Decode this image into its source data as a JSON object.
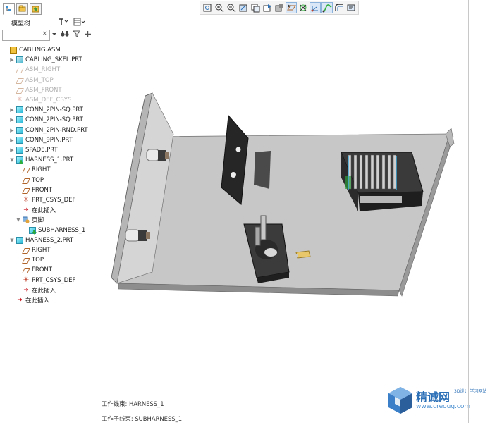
{
  "left_panel": {
    "tree_title": "模型树",
    "search": {
      "value": "",
      "clear_label": "×"
    },
    "items": [
      {
        "label": "CABLING.ASM",
        "icon": "assembly-icon",
        "toggle": "",
        "dim": false
      },
      {
        "label": "CABLING_SKEL.PRT",
        "icon": "skeleton-icon",
        "toggle": "▶",
        "dim": false
      },
      {
        "label": "ASM_RIGHT",
        "icon": "datum-plane-icon",
        "toggle": "",
        "dim": true
      },
      {
        "label": "ASM_TOP",
        "icon": "datum-plane-icon",
        "toggle": "",
        "dim": true
      },
      {
        "label": "ASM_FRONT",
        "icon": "datum-plane-icon",
        "toggle": "",
        "dim": true
      },
      {
        "label": "ASM_DEF_CSYS",
        "icon": "csys-icon",
        "toggle": "",
        "dim": true
      },
      {
        "label": "CONN_2PIN-SQ.PRT",
        "icon": "part-icon",
        "toggle": "▶",
        "dim": false
      },
      {
        "label": "CONN_2PIN-SQ.PRT",
        "icon": "part-icon",
        "toggle": "▶",
        "dim": false
      },
      {
        "label": "CONN_2PIN-RND.PRT",
        "icon": "part-icon",
        "toggle": "▶",
        "dim": false
      },
      {
        "label": "CONN_9PIN.PRT",
        "icon": "part-icon",
        "toggle": "▶",
        "dim": false
      },
      {
        "label": "SPADE.PRT",
        "icon": "part-icon",
        "toggle": "▶",
        "dim": false
      },
      {
        "label": "HARNESS_1.PRT",
        "icon": "harness-part-icon",
        "toggle": "▼",
        "dim": false
      },
      {
        "label": "RIGHT",
        "icon": "datum-plane-icon",
        "toggle": "",
        "dim": false
      },
      {
        "label": "TOP",
        "icon": "datum-plane-icon",
        "toggle": "",
        "dim": false
      },
      {
        "label": "FRONT",
        "icon": "datum-plane-icon",
        "toggle": "",
        "dim": false
      },
      {
        "label": "PRT_CSYS_DEF",
        "icon": "csys-icon",
        "toggle": "",
        "dim": false
      },
      {
        "label": "在此插入",
        "icon": "insert-here-icon",
        "toggle": "",
        "dim": false
      },
      {
        "label": "页脚",
        "icon": "footer-icon",
        "toggle": "▼",
        "dim": false
      },
      {
        "label": "SUBHARNESS_1",
        "icon": "subharness-icon",
        "toggle": "",
        "dim": false
      },
      {
        "label": "HARNESS_2.PRT",
        "icon": "part-icon",
        "toggle": "▼",
        "dim": false
      },
      {
        "label": "RIGHT",
        "icon": "datum-plane-icon",
        "toggle": "",
        "dim": false
      },
      {
        "label": "TOP",
        "icon": "datum-plane-icon",
        "toggle": "",
        "dim": false
      },
      {
        "label": "FRONT",
        "icon": "datum-plane-icon",
        "toggle": "",
        "dim": false
      },
      {
        "label": "PRT_CSYS_DEF",
        "icon": "csys-icon",
        "toggle": "",
        "dim": false
      },
      {
        "label": "在此插入",
        "icon": "insert-here-icon",
        "toggle": "",
        "dim": false
      },
      {
        "label": "在此插入",
        "icon": "insert-here-icon",
        "toggle": "",
        "dim": false
      }
    ]
  },
  "toolbar": {
    "buttons": [
      "refit-icon",
      "zoom-in-icon",
      "zoom-out-icon",
      "repaint-icon",
      "view-manager-icon",
      "saved-views-icon",
      "display-style-icon",
      "datum-display-icon",
      "spin-center-icon",
      "csys-display-icon",
      "cable-display-icon",
      "wire-icon",
      "annotation-display-icon"
    ]
  },
  "status": {
    "harness": "工作线束: HARNESS_1",
    "subharness": "工作子线束: SUBHARNESS_1"
  },
  "watermark": {
    "brand": "精诚网",
    "tagline": "3D设计 学习网站",
    "url": "www.creoug.com"
  },
  "colors": {
    "accent": "#2b6fb6",
    "plate": "#bdbdbd",
    "panel_border": "#b9b9b9"
  }
}
